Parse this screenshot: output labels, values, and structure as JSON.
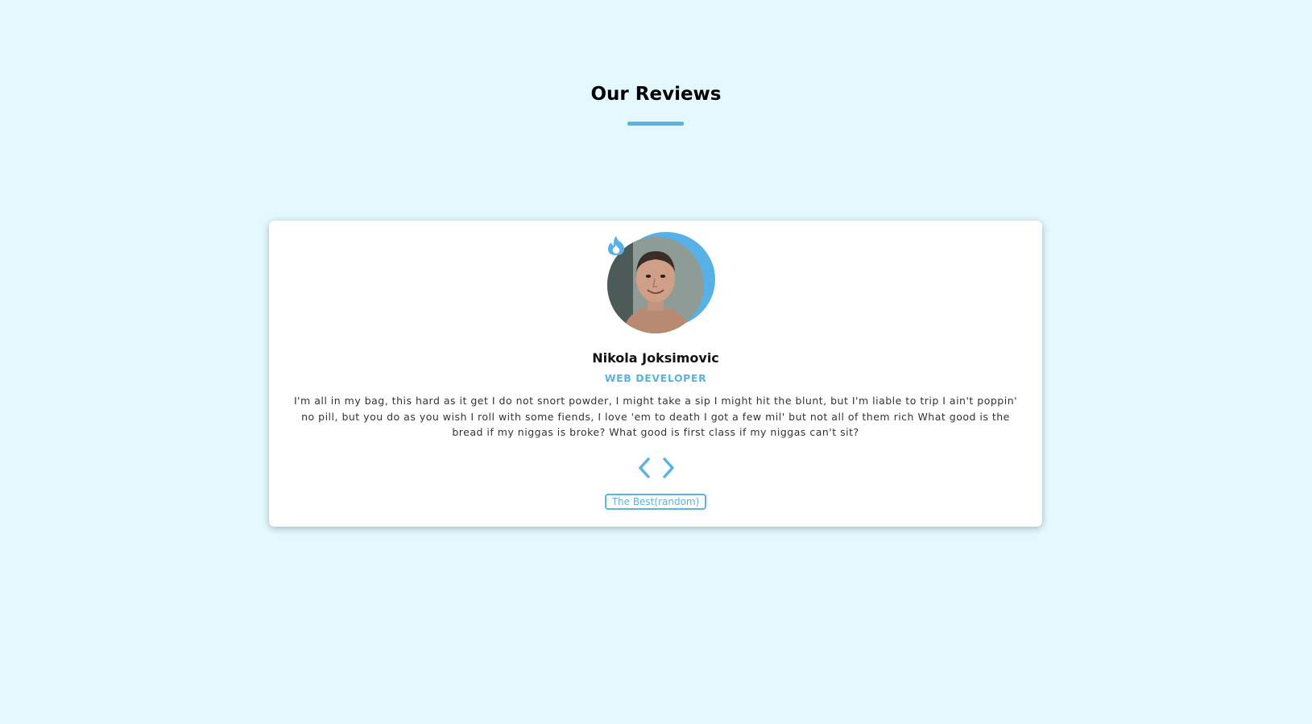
{
  "header": {
    "title": "Our Reviews"
  },
  "review": {
    "name": "Nikola Joksimovic",
    "role": "WEB DEVELOPER",
    "text": "I'm all in my bag, this hard as it get I do not snort powder, I might take a sip I might hit the blunt, but I'm liable to trip I ain't poppin' no pill, but you do as you wish I roll with some fiends, I love 'em to death I got a few mil' but not all of them rich What good is the bread if my niggas is broke? What good is first class if my niggas can't sit?",
    "avatar_alt": "Nikola Joksimovic"
  },
  "controls": {
    "prev_icon": "chevron-left-icon",
    "next_icon": "chevron-right-icon",
    "random_label": "The Best(random)"
  },
  "theme": {
    "background": "#e3f9fe",
    "accent": "#5ab3e0",
    "card": "#ffffff"
  }
}
